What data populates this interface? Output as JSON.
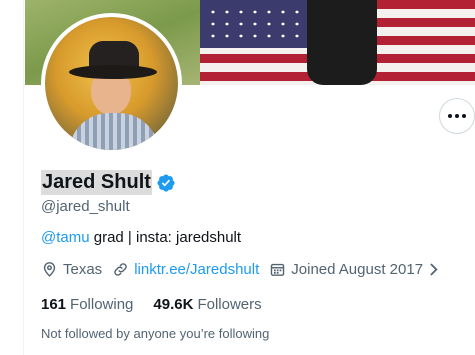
{
  "profile": {
    "display_name": "Jared Shult",
    "handle": "@jared_shult",
    "bio": {
      "mention": "@tamu",
      "text": " grad | insta: jaredshult"
    },
    "location": "Texas",
    "link": "linktr.ee/Jaredshult",
    "joined": "Joined August 2017",
    "following_count": "161",
    "following_label": "Following",
    "followers_count": "49.6K",
    "followers_label": "Followers",
    "followed_by_text": "Not followed by anyone you’re following"
  },
  "colors": {
    "accent": "#1d9bf0",
    "secondary_text": "#536471",
    "primary_text": "#0f1419"
  },
  "icons": [
    "more-icon",
    "verified-badge-icon",
    "location-pin-icon",
    "link-icon",
    "calendar-icon",
    "chevron-right-icon"
  ]
}
